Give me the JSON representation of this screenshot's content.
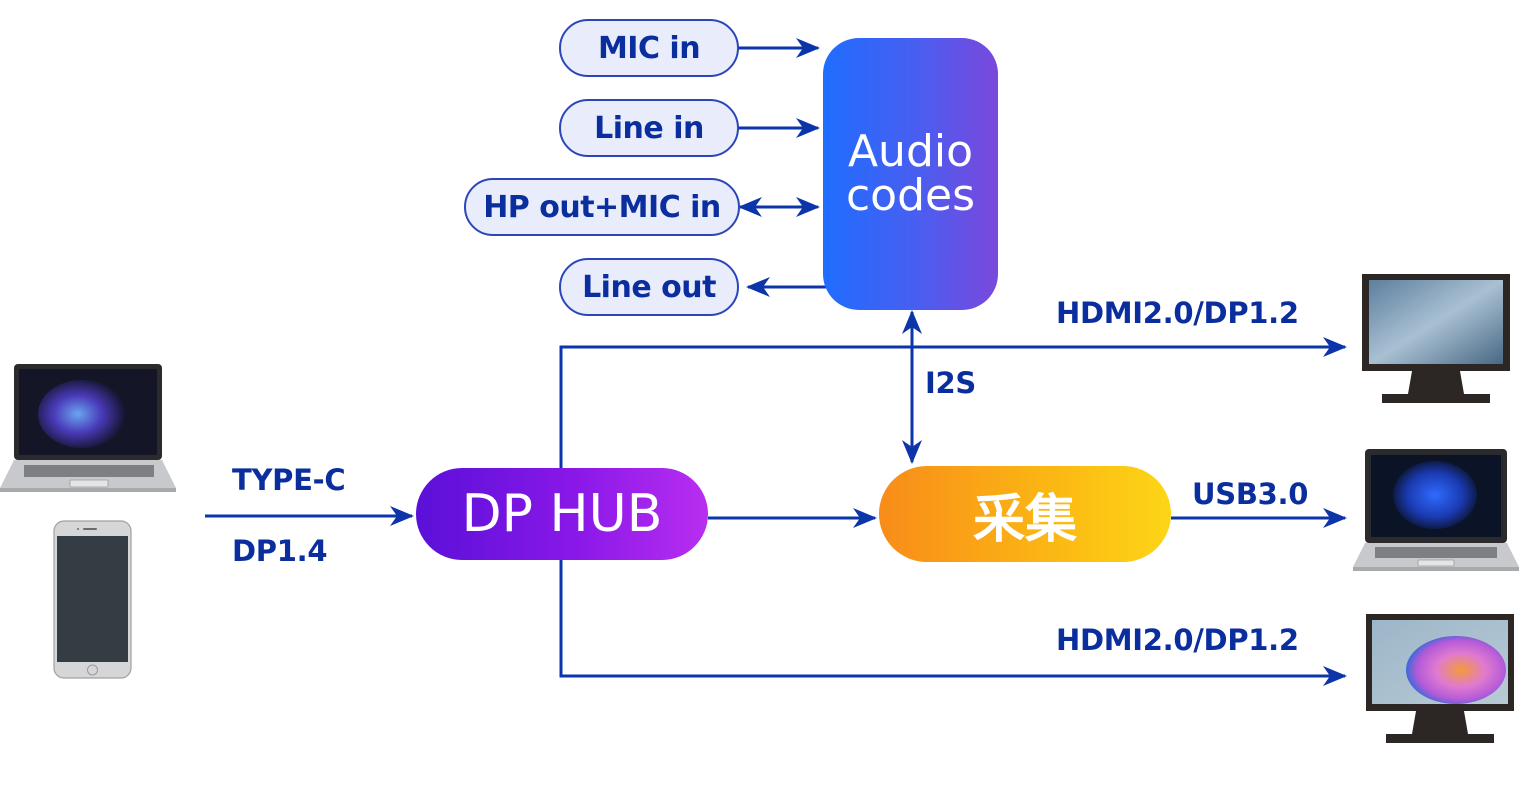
{
  "colors": {
    "wire": "#0b35a8",
    "label_text": "#0b2e9e",
    "pill_fill": "#e8ecfb",
    "audio_gradient": [
      "#1f6dff",
      "#7a48dc"
    ],
    "dphub_gradient": [
      "#5a10d8",
      "#b82ef0"
    ],
    "capture_gradient": [
      "#f88c1a",
      "#fdd616"
    ]
  },
  "audio_inputs": [
    {
      "label": "MIC in",
      "direction": "to-codec"
    },
    {
      "label": "Line in",
      "direction": "to-codec"
    },
    {
      "label": "HP out+MIC in",
      "direction": "bidirectional"
    },
    {
      "label": "Line out",
      "direction": "from-codec"
    }
  ],
  "nodes": {
    "audio_codec": {
      "line1": "Audio",
      "line2": "codes"
    },
    "dp_hub": {
      "label": "DP HUB"
    },
    "capture": {
      "label": "采集"
    }
  },
  "links": {
    "input_top": "TYPE-C",
    "input_bottom": "DP1.4",
    "i2s": "I2S",
    "out_top": "HDMI2.0/DP1.2",
    "usb": "USB3.0",
    "out_bottom": "HDMI2.0/DP1.2"
  },
  "devices": {
    "sources": [
      "laptop",
      "smartphone"
    ],
    "outputs": [
      "monitor",
      "laptop",
      "monitor"
    ]
  }
}
